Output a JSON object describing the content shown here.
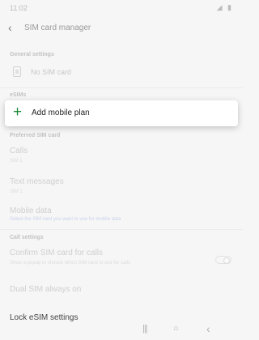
{
  "status_bar": {
    "time": "11:02",
    "icons": [
      "signal-icon",
      "battery-icon"
    ],
    "icons_text": "◢ ▮"
  },
  "header": {
    "back_icon": "‹",
    "title": "SIM card manager"
  },
  "general_settings": {
    "label": "General settings",
    "no_sim": "No SIM card"
  },
  "esims": {
    "label": "eSIMs",
    "add_icon": "+",
    "add_label": "Add mobile plan"
  },
  "preferred_sim": {
    "label": "Preferred SIM card",
    "calls": {
      "title": "Calls",
      "sub": "SIM 1"
    },
    "text_messages": {
      "title": "Text messages",
      "sub": "SIM 1"
    },
    "mobile_data": {
      "title": "Mobile data",
      "sub": "Select the SIM card you want to use for mobile data"
    }
  },
  "call_settings": {
    "label": "Call settings",
    "confirm": {
      "title": "Confirm SIM card for calls",
      "sub": "Show a popup to choose which SIM card to use for calls"
    },
    "dual_sim": {
      "title": "Dual SIM always on"
    },
    "lock_esim": {
      "title": "Lock eSIM settings"
    }
  },
  "nav_bar": {
    "recents": "|||",
    "home": "○",
    "back": "‹"
  }
}
